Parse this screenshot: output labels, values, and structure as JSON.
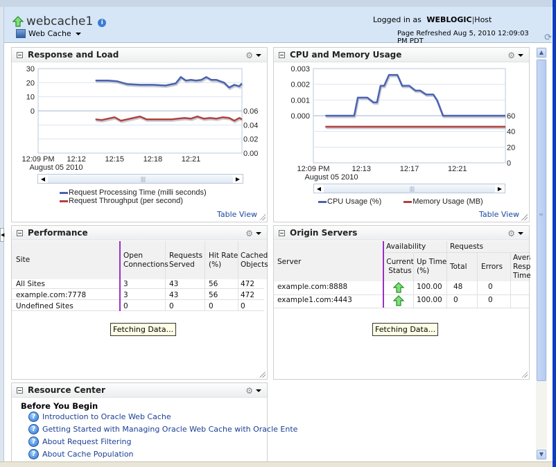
{
  "header": {
    "title": "webcache1",
    "menu_label": "Web Cache",
    "logged_in_prefix": "Logged in as",
    "user": "WEBLOGIC",
    "separator": "|",
    "host_label": "Host",
    "page_refreshed": "Page Refreshed Aug 5, 2010 12:09:03 PM PDT"
  },
  "response_load": {
    "title": "Response and Load",
    "table_view": "Table View",
    "date_label": "August 05 2010",
    "chart_data": {
      "type": "line",
      "title": "Response and Load",
      "x_ticks": [
        "12:09 PM",
        "12:12",
        "12:15",
        "12:18",
        "12:21"
      ],
      "x_range_minutes": [
        0,
        16
      ],
      "y_left_ticks": [
        "30",
        "20",
        "10",
        "0"
      ],
      "y_left_range": [
        0,
        30
      ],
      "y_right_ticks": [
        "0.06",
        "0.04",
        "0.02",
        "0.00"
      ],
      "y_right_range": [
        0,
        0.06
      ],
      "legend": [
        "Request Processing Time (milli seconds)",
        "Request Throughput (per second)"
      ],
      "series": [
        {
          "name": "Request Processing Time (milli seconds)",
          "axis": "left",
          "color": "#4a62b0",
          "x": [
            4.5,
            5.5,
            6.2,
            7.0,
            8.0,
            9.0,
            10.0,
            10.8,
            11.2,
            11.6,
            12.0,
            12.4,
            12.8,
            13.2,
            13.6,
            14.0,
            14.6,
            15.0,
            15.4,
            15.8,
            16.0
          ],
          "y": [
            21.5,
            21.5,
            21.0,
            19.0,
            18.5,
            18.5,
            18.0,
            19.5,
            24.0,
            21.5,
            22.0,
            21.5,
            22.0,
            24.0,
            22.0,
            22.0,
            20.0,
            16.5,
            18.5,
            17.5,
            19.5
          ]
        },
        {
          "name": "Request Throughput (per second)",
          "axis": "right",
          "color": "#b0413e",
          "x": [
            4.5,
            5.0,
            6.0,
            6.5,
            8.0,
            8.5,
            9.5,
            10.5,
            11.5,
            12.0,
            12.5,
            13.0,
            13.5,
            14.0,
            14.5,
            15.0,
            15.4,
            15.8,
            16.0
          ],
          "y": [
            0.048,
            0.047,
            0.051,
            0.046,
            0.052,
            0.048,
            0.048,
            0.048,
            0.05,
            0.049,
            0.052,
            0.049,
            0.05,
            0.049,
            0.051,
            0.05,
            0.046,
            0.05,
            0.048
          ]
        }
      ]
    }
  },
  "cpu_memory": {
    "title": "CPU and Memory Usage",
    "table_view": "Table View",
    "date_label": "August 05 2010",
    "chart_data": {
      "type": "line",
      "title": "CPU and Memory Usage",
      "x_ticks": [
        "12:09 PM",
        "12:13",
        "12:17",
        "12:21"
      ],
      "x_range_minutes": [
        0,
        16
      ],
      "y_left_ticks": [
        "0.003",
        "0.002",
        "0.001",
        "0.000"
      ],
      "y_left_range": [
        0,
        0.003
      ],
      "y_right_ticks": [
        "60",
        "40",
        "20",
        "0"
      ],
      "y_right_range": [
        0,
        60
      ],
      "legend": [
        "CPU Usage (%)",
        "Memory Usage (MB)"
      ],
      "series": [
        {
          "name": "CPU Usage (%)",
          "axis": "left",
          "color": "#4a62b0",
          "x": [
            1.0,
            3.4,
            3.7,
            4.5,
            5.0,
            5.3,
            5.6,
            5.9,
            6.3,
            7.0,
            7.4,
            8.0,
            8.5,
            8.9,
            9.4,
            10.0,
            10.3,
            10.8,
            16.0
          ],
          "y": [
            0.0,
            0.0,
            0.00115,
            0.00115,
            0.00085,
            0.00085,
            0.0019,
            0.0019,
            0.0026,
            0.0026,
            0.0019,
            0.0019,
            0.0016,
            0.0016,
            0.00135,
            0.00135,
            0.001,
            0.0,
            0.0
          ]
        },
        {
          "name": "Memory Usage (MB)",
          "axis": "right",
          "color": "#b0413e",
          "x": [
            1.0,
            16.0
          ],
          "y": [
            46,
            46
          ]
        }
      ]
    }
  },
  "performance": {
    "title": "Performance",
    "columns": [
      "Site",
      "Open Connections",
      "Requests Served",
      "Hit Rate (%)",
      "Cached Objects"
    ],
    "rows": [
      [
        "All Sites",
        "3",
        "43",
        "56",
        "472"
      ],
      [
        "example.com:7778",
        "3",
        "43",
        "56",
        "472"
      ],
      [
        "Undefined Sites",
        "0",
        "0",
        "0",
        "0"
      ]
    ],
    "fetching": "Fetching Data..."
  },
  "origin_servers": {
    "title": "Origin Servers",
    "group_headers": [
      "Availability",
      "Requests"
    ],
    "columns": [
      "Server",
      "Current Status",
      "Up Time (%)",
      "Total",
      "Errors",
      "Average Response Time"
    ],
    "rows": [
      {
        "server": "example.com:8888",
        "status": "up",
        "uptime": "100.00",
        "total": "48",
        "errors": "0"
      },
      {
        "server": "example1.com:4443",
        "status": "up",
        "uptime": "100.00",
        "total": "0",
        "errors": "0"
      }
    ],
    "fetching": "Fetching Data..."
  },
  "resource_center": {
    "title": "Resource Center",
    "heading": "Before You Begin",
    "links": [
      "Introduction to Oracle Web Cache",
      "Getting Started with Managing Oracle Web Cache with Oracle Ente",
      "About Request Filtering",
      "About Cache Population"
    ]
  }
}
